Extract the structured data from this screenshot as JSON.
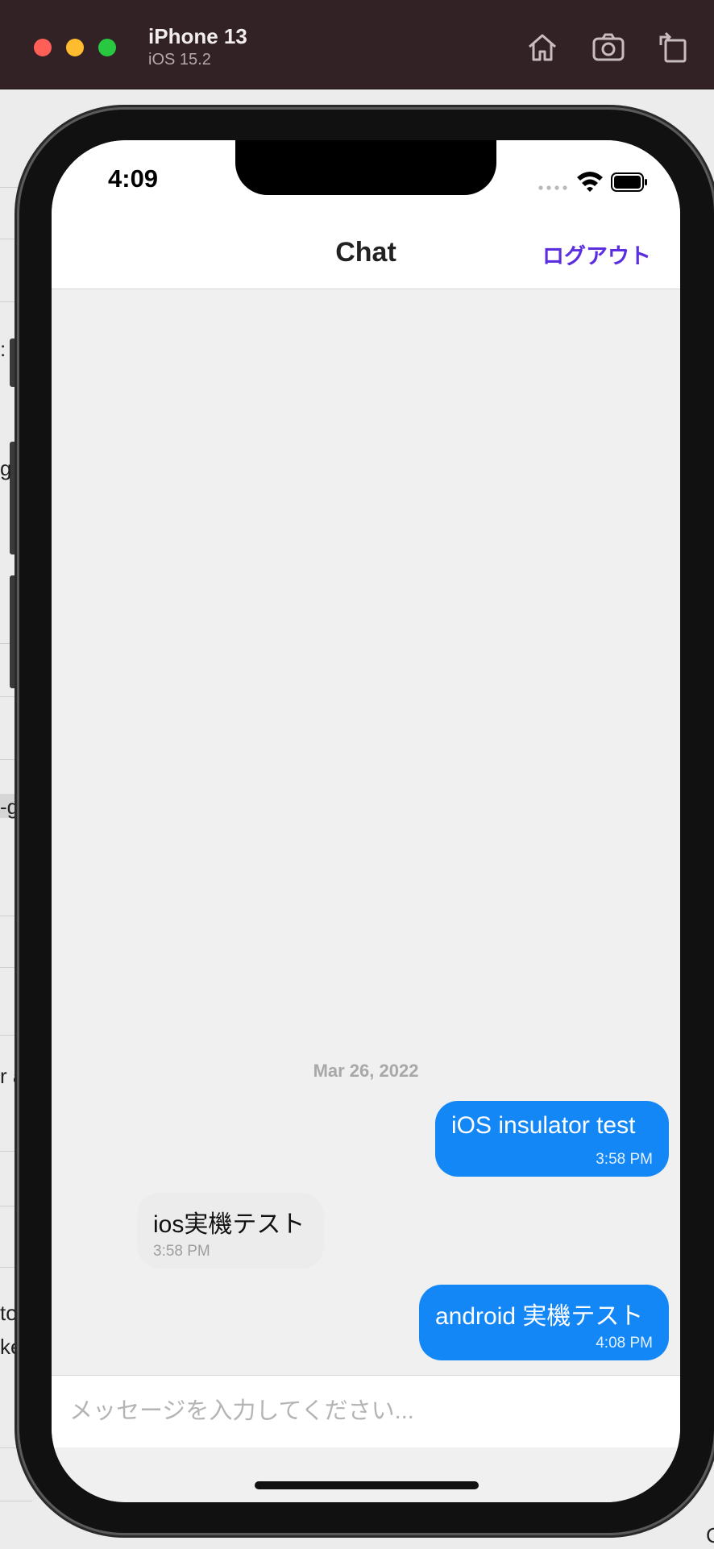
{
  "simulator": {
    "device_name": "iPhone 13",
    "os_version": "iOS 15.2",
    "buttons": [
      {
        "name": "home-icon"
      },
      {
        "name": "screenshot-icon"
      },
      {
        "name": "rotate-icon"
      }
    ]
  },
  "background_fragments": [
    ":",
    "g",
    "-g",
    "r a",
    "to",
    "ke",
    "C"
  ],
  "status_bar": {
    "time": "4:09"
  },
  "nav": {
    "title": "Chat",
    "logout_label": "ログアウト"
  },
  "chat": {
    "date_separator": "Mar 26, 2022",
    "messages": [
      {
        "direction": "outgoing",
        "text": "iOS insulator test",
        "time": "3:58 PM"
      },
      {
        "direction": "incoming",
        "text": "ios実機テスト",
        "time": "3:58 PM"
      },
      {
        "direction": "outgoing",
        "text": "android 実機テスト",
        "time": "4:08 PM"
      }
    ]
  },
  "composer": {
    "placeholder": "メッセージを入力してください...",
    "value": ""
  },
  "colors": {
    "accent": "#5b2ee0",
    "outgoing_bubble": "#1487f7",
    "incoming_bubble": "#ececec",
    "titlebar": "#322226"
  }
}
